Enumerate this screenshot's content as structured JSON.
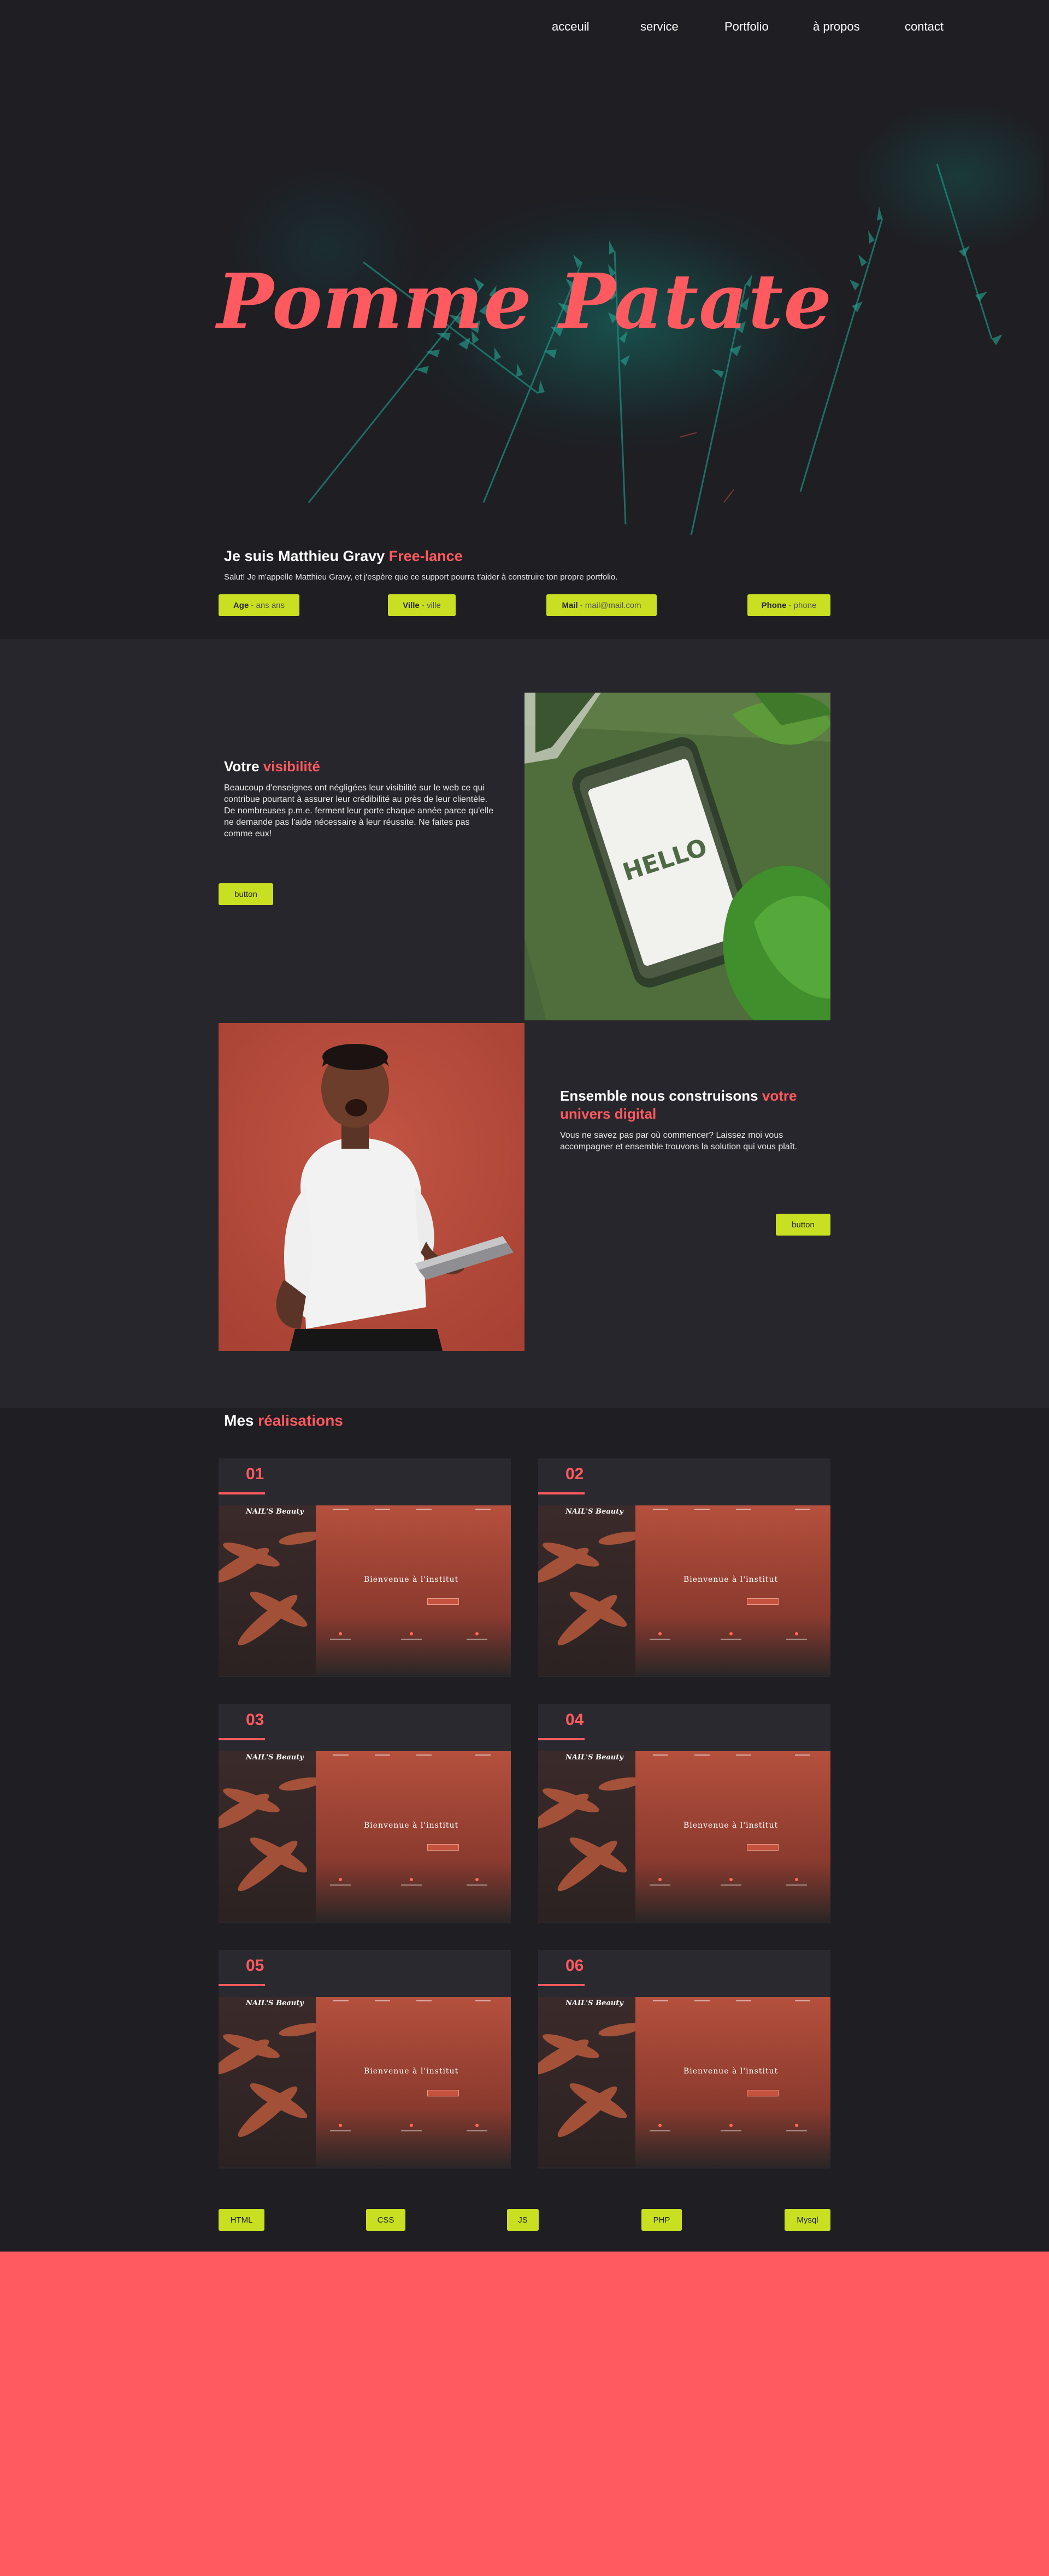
{
  "nav": {
    "items": [
      "acceuil",
      "service",
      "Portfolio",
      "à propos",
      "contact"
    ]
  },
  "hero": {
    "title": "Pomme Patate"
  },
  "intro": {
    "title_prefix": "Je suis Matthieu Gravy",
    "title_highlight": "Free-lance",
    "text": "Salut! Je m'appelle Matthieu Gravy, et j'espère que ce support pourra t'aider à construire ton propre portfolio.",
    "pills": [
      {
        "label": "Age",
        "value": "- ans ans"
      },
      {
        "label": "Ville",
        "value": "- ville"
      },
      {
        "label": "Mail",
        "value": "- mail@mail.com"
      },
      {
        "label": "Phone",
        "value": "- phone"
      }
    ]
  },
  "visibility": {
    "title_prefix": "Votre",
    "title_highlight": "visibilité",
    "text": "Beaucoup d'enseignes ont négligées leur visibilité sur le web ce qui contribue pourtant à assurer leur crédibilité au près de leur clientèle. De nombreuses p.m.e. ferment leur porte chaque année parce qu'elle ne demande pas l'aide nécessaire à leur réussite. Ne faites pas comme eux!",
    "button": "button",
    "photo_text": "HELLO"
  },
  "together": {
    "title_prefix": "Ensemble nous construisons",
    "title_highlight": "votre univers digital",
    "text": "Vous ne savez pas par où commencer? Laissez moi vous accompagner et ensemble trouvons la solution qui vous plaît.",
    "button": "button"
  },
  "portfolio": {
    "title_prefix": "Mes",
    "title_highlight": "réalisations",
    "cards": [
      {
        "num": "01",
        "logo": "NAIL'S Beauty",
        "heading": "Bienvenue à l'institut"
      },
      {
        "num": "02",
        "logo": "NAIL'S Beauty",
        "heading": "Bienvenue à l'institut"
      },
      {
        "num": "03",
        "logo": "NAIL'S Beauty",
        "heading": "Bienvenue à l'institut"
      },
      {
        "num": "04",
        "logo": "NAIL'S Beauty",
        "heading": "Bienvenue à l'institut"
      },
      {
        "num": "05",
        "logo": "NAIL'S Beauty",
        "heading": "Bienvenue à l'institut"
      },
      {
        "num": "06",
        "logo": "NAIL'S Beauty",
        "heading": "Bienvenue à l'institut"
      }
    ]
  },
  "skills": [
    "HTML",
    "CSS",
    "JS",
    "PHP",
    "Mysql"
  ],
  "colors": {
    "accent": "#ff5a5f",
    "lime": "#c8e021",
    "bg_dark": "#1e1e23",
    "bg_section": "#27262c"
  }
}
